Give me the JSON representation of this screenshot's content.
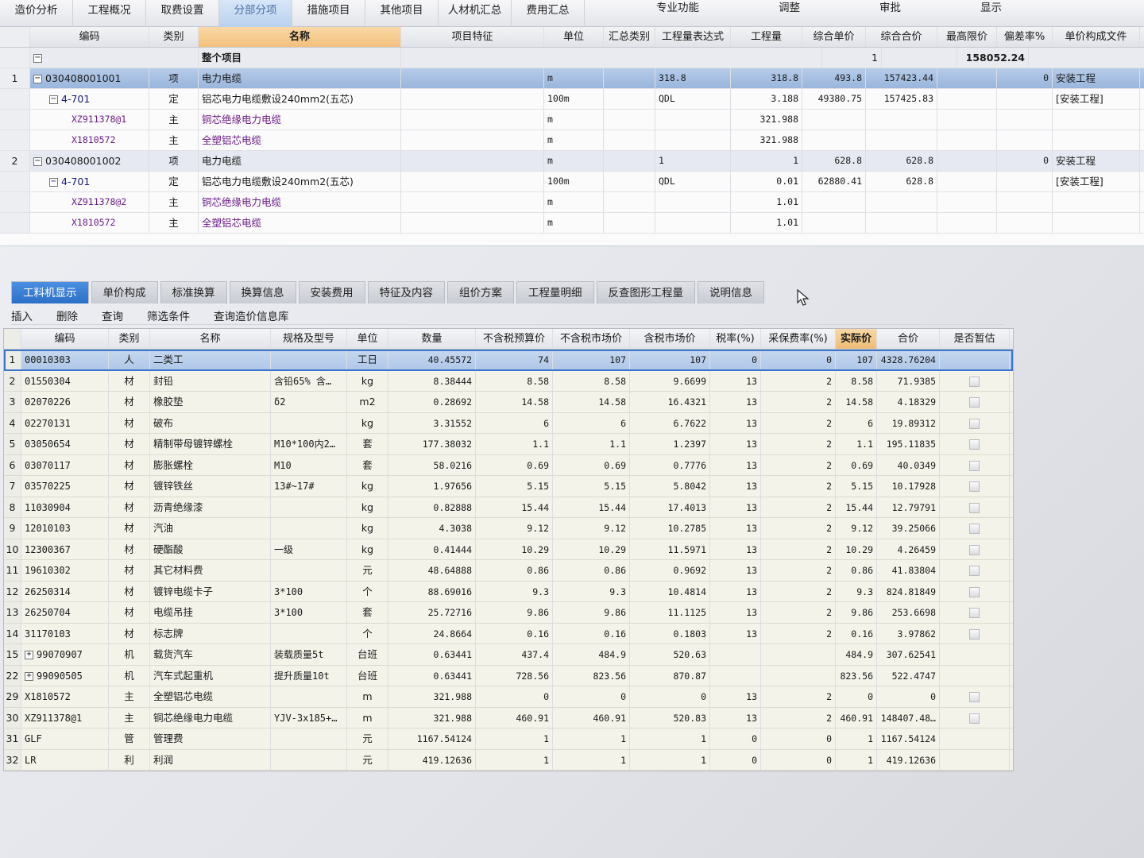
{
  "menu": {
    "tabs": [
      "造价分析",
      "工程概况",
      "取费设置",
      "分部分项",
      "措施项目",
      "其他项目",
      "人材机汇总",
      "费用汇总"
    ],
    "active_index": 3,
    "right": [
      "专业功能",
      "调整",
      "审批",
      "显示"
    ]
  },
  "upper": {
    "headers": [
      "编码",
      "类别",
      "名称",
      "项目特征",
      "单位",
      "汇总类别",
      "工程量表达式",
      "工程量",
      "综合单价",
      "综合合价",
      "最高限价",
      "偏差率%",
      "单价构成文件"
    ],
    "summary_row": {
      "label": "整个项目",
      "qty": "1",
      "total": "158052.24"
    },
    "rows": [
      {
        "no": "1",
        "code": "030408001001",
        "type": "项",
        "name": "电力电缆",
        "unit": "m",
        "expr": "318.8",
        "qty": "318.8",
        "price": "493.8",
        "total": "157423.44",
        "limit": "",
        "dev": "0",
        "file": "安装工程",
        "level": 1,
        "sel": true
      },
      {
        "no": "",
        "code": "4-701",
        "type": "定",
        "name": "铝芯电力电缆敷设240mm2(五芯)",
        "unit": "100m",
        "expr": "QDL",
        "qty": "3.188",
        "price": "49380.75",
        "total": "157425.83",
        "limit": "",
        "dev": "",
        "file": "[安装工程]",
        "level": 2
      },
      {
        "no": "",
        "code": "XZ911378@1",
        "type": "主",
        "name": "铜芯绝缘电力电缆",
        "unit": "m",
        "expr": "",
        "qty": "321.988",
        "price": "",
        "total": "",
        "limit": "",
        "dev": "",
        "file": "",
        "level": 3
      },
      {
        "no": "",
        "code": "X1810572",
        "type": "主",
        "name": "全塑铝芯电缆",
        "unit": "m",
        "expr": "",
        "qty": "321.988",
        "price": "",
        "total": "",
        "limit": "",
        "dev": "",
        "file": "",
        "level": 3
      },
      {
        "no": "2",
        "code": "030408001002",
        "type": "项",
        "name": "电力电缆",
        "unit": "m",
        "expr": "1",
        "qty": "1",
        "price": "628.8",
        "total": "628.8",
        "limit": "",
        "dev": "0",
        "file": "安装工程",
        "level": 1
      },
      {
        "no": "",
        "code": "4-701",
        "type": "定",
        "name": "铝芯电力电缆敷设240mm2(五芯)",
        "unit": "100m",
        "expr": "QDL",
        "qty": "0.01",
        "price": "62880.41",
        "total": "628.8",
        "limit": "",
        "dev": "",
        "file": "[安装工程]",
        "level": 2
      },
      {
        "no": "",
        "code": "XZ911378@2",
        "type": "主",
        "name": "铜芯绝缘电力电缆",
        "unit": "m",
        "expr": "",
        "qty": "1.01",
        "price": "",
        "total": "",
        "limit": "",
        "dev": "",
        "file": "",
        "level": 3
      },
      {
        "no": "",
        "code": "X1810572",
        "type": "主",
        "name": "全塑铝芯电缆",
        "unit": "m",
        "expr": "",
        "qty": "1.01",
        "price": "",
        "total": "",
        "limit": "",
        "dev": "",
        "file": "",
        "level": 3
      }
    ]
  },
  "lower_tabs": [
    "工料机显示",
    "单价构成",
    "标准换算",
    "换算信息",
    "安装费用",
    "特征及内容",
    "组价方案",
    "工程量明细",
    "反查图形工程量",
    "说明信息"
  ],
  "lower_active": 0,
  "toolbar": [
    "插入",
    "删除",
    "查询",
    "筛选条件",
    "查询造价信息库"
  ],
  "lower": {
    "headers": [
      "编码",
      "类别",
      "名称",
      "规格及型号",
      "单位",
      "数量",
      "不含税预算价",
      "不含税市场价",
      "含税市场价",
      "税率(%)",
      "采保费率(%)",
      "实际价",
      "合价",
      "是否暂估"
    ],
    "rows": [
      {
        "no": "1",
        "code": "00010303",
        "type": "人",
        "name": "二类工",
        "spec": "",
        "unit": "工日",
        "qty": "40.45572",
        "budget": "74",
        "market": "107",
        "market_tax": "107",
        "tax": "0",
        "fee": "0",
        "actual": "107",
        "total": "4328.76204",
        "chk": false,
        "expand": false,
        "sel": true
      },
      {
        "no": "2",
        "code": "01550304",
        "type": "材",
        "name": "封铅",
        "spec": "含铅65% 含…",
        "unit": "kg",
        "qty": "8.38444",
        "budget": "8.58",
        "market": "8.58",
        "market_tax": "9.6699",
        "tax": "13",
        "fee": "2",
        "actual": "8.58",
        "total": "71.9385",
        "chk": true
      },
      {
        "no": "3",
        "code": "02070226",
        "type": "材",
        "name": "橡胶垫",
        "spec": "δ2",
        "unit": "m2",
        "qty": "0.28692",
        "budget": "14.58",
        "market": "14.58",
        "market_tax": "16.4321",
        "tax": "13",
        "fee": "2",
        "actual": "14.58",
        "total": "4.18329",
        "chk": true
      },
      {
        "no": "4",
        "code": "02270131",
        "type": "材",
        "name": "破布",
        "spec": "",
        "unit": "kg",
        "qty": "3.31552",
        "budget": "6",
        "market": "6",
        "market_tax": "6.7622",
        "tax": "13",
        "fee": "2",
        "actual": "6",
        "total": "19.89312",
        "chk": true
      },
      {
        "no": "5",
        "code": "03050654",
        "type": "材",
        "name": "精制带母镀锌螺栓",
        "spec": "M10*100内2…",
        "unit": "套",
        "qty": "177.38032",
        "budget": "1.1",
        "market": "1.1",
        "market_tax": "1.2397",
        "tax": "13",
        "fee": "2",
        "actual": "1.1",
        "total": "195.11835",
        "chk": true
      },
      {
        "no": "6",
        "code": "03070117",
        "type": "材",
        "name": "膨胀螺栓",
        "spec": "M10",
        "unit": "套",
        "qty": "58.0216",
        "budget": "0.69",
        "market": "0.69",
        "market_tax": "0.7776",
        "tax": "13",
        "fee": "2",
        "actual": "0.69",
        "total": "40.0349",
        "chk": true
      },
      {
        "no": "7",
        "code": "03570225",
        "type": "材",
        "name": "镀锌铁丝",
        "spec": "13#~17#",
        "unit": "kg",
        "qty": "1.97656",
        "budget": "5.15",
        "market": "5.15",
        "market_tax": "5.8042",
        "tax": "13",
        "fee": "2",
        "actual": "5.15",
        "total": "10.17928",
        "chk": true
      },
      {
        "no": "8",
        "code": "11030904",
        "type": "材",
        "name": "沥青绝缘漆",
        "spec": "",
        "unit": "kg",
        "qty": "0.82888",
        "budget": "15.44",
        "market": "15.44",
        "market_tax": "17.4013",
        "tax": "13",
        "fee": "2",
        "actual": "15.44",
        "total": "12.79791",
        "chk": true
      },
      {
        "no": "9",
        "code": "12010103",
        "type": "材",
        "name": "汽油",
        "spec": "",
        "unit": "kg",
        "qty": "4.3038",
        "budget": "9.12",
        "market": "9.12",
        "market_tax": "10.2785",
        "tax": "13",
        "fee": "2",
        "actual": "9.12",
        "total": "39.25066",
        "chk": true
      },
      {
        "no": "10",
        "code": "12300367",
        "type": "材",
        "name": "硬酯酸",
        "spec": "一级",
        "unit": "kg",
        "qty": "0.41444",
        "budget": "10.29",
        "market": "10.29",
        "market_tax": "11.5971",
        "tax": "13",
        "fee": "2",
        "actual": "10.29",
        "total": "4.26459",
        "chk": true
      },
      {
        "no": "11",
        "code": "19610302",
        "type": "材",
        "name": "其它材料费",
        "spec": "",
        "unit": "元",
        "qty": "48.64888",
        "budget": "0.86",
        "market": "0.86",
        "market_tax": "0.9692",
        "tax": "13",
        "fee": "2",
        "actual": "0.86",
        "total": "41.83804",
        "chk": true
      },
      {
        "no": "12",
        "code": "26250314",
        "type": "材",
        "name": "镀锌电缆卡子",
        "spec": "3*100",
        "unit": "个",
        "qty": "88.69016",
        "budget": "9.3",
        "market": "9.3",
        "market_tax": "10.4814",
        "tax": "13",
        "fee": "2",
        "actual": "9.3",
        "total": "824.81849",
        "chk": true
      },
      {
        "no": "13",
        "code": "26250704",
        "type": "材",
        "name": "电缆吊挂",
        "spec": "3*100",
        "unit": "套",
        "qty": "25.72716",
        "budget": "9.86",
        "market": "9.86",
        "market_tax": "11.1125",
        "tax": "13",
        "fee": "2",
        "actual": "9.86",
        "total": "253.6698",
        "chk": true
      },
      {
        "no": "14",
        "code": "31170103",
        "type": "材",
        "name": "标志牌",
        "spec": "",
        "unit": "个",
        "qty": "24.8664",
        "budget": "0.16",
        "market": "0.16",
        "market_tax": "0.1803",
        "tax": "13",
        "fee": "2",
        "actual": "0.16",
        "total": "3.97862",
        "chk": true
      },
      {
        "no": "15",
        "code": "99070907",
        "type": "机",
        "name": "载货汽车",
        "spec": "装载质量5t",
        "unit": "台班",
        "qty": "0.63441",
        "budget": "437.4",
        "market": "484.9",
        "market_tax": "520.63",
        "tax": "",
        "fee": "",
        "actual": "484.9",
        "total": "307.62541",
        "chk": false,
        "expand": true
      },
      {
        "no": "22",
        "code": "99090505",
        "type": "机",
        "name": "汽车式起重机",
        "spec": "提升质量10t",
        "unit": "台班",
        "qty": "0.63441",
        "budget": "728.56",
        "market": "823.56",
        "market_tax": "870.87",
        "tax": "",
        "fee": "",
        "actual": "823.56",
        "total": "522.4747",
        "chk": false,
        "expand": true
      },
      {
        "no": "29",
        "code": "X1810572",
        "type": "主",
        "name": "全塑铝芯电缆",
        "spec": "",
        "unit": "m",
        "qty": "321.988",
        "budget": "0",
        "market": "0",
        "market_tax": "0",
        "tax": "13",
        "fee": "2",
        "actual": "0",
        "total": "0",
        "chk": true
      },
      {
        "no": "30",
        "code": "XZ911378@1",
        "type": "主",
        "name": "铜芯绝缘电力电缆",
        "spec": "YJV-3x185+…",
        "unit": "m",
        "qty": "321.988",
        "budget": "460.91",
        "market": "460.91",
        "market_tax": "520.83",
        "tax": "13",
        "fee": "2",
        "actual": "460.91",
        "total": "148407.48…",
        "chk": true
      },
      {
        "no": "31",
        "code": "GLF",
        "type": "管",
        "name": "管理费",
        "spec": "",
        "unit": "元",
        "qty": "1167.54124",
        "budget": "1",
        "market": "1",
        "market_tax": "1",
        "tax": "0",
        "fee": "0",
        "actual": "1",
        "total": "1167.54124",
        "chk": false
      },
      {
        "no": "32",
        "code": "LR",
        "type": "利",
        "name": "利润",
        "spec": "",
        "unit": "元",
        "qty": "419.12636",
        "budget": "1",
        "market": "1",
        "market_tax": "1",
        "tax": "0",
        "fee": "0",
        "actual": "1",
        "total": "419.12636",
        "chk": false
      }
    ]
  },
  "icons": {
    "cursor": "mouse-pointer-icon",
    "expand": "plus-box-icon",
    "collapse": "minus-box-icon"
  },
  "colors": {
    "accent": "#2b6fc8",
    "header_highlight": "#f2c07c",
    "material_text": "#6a1c88"
  }
}
